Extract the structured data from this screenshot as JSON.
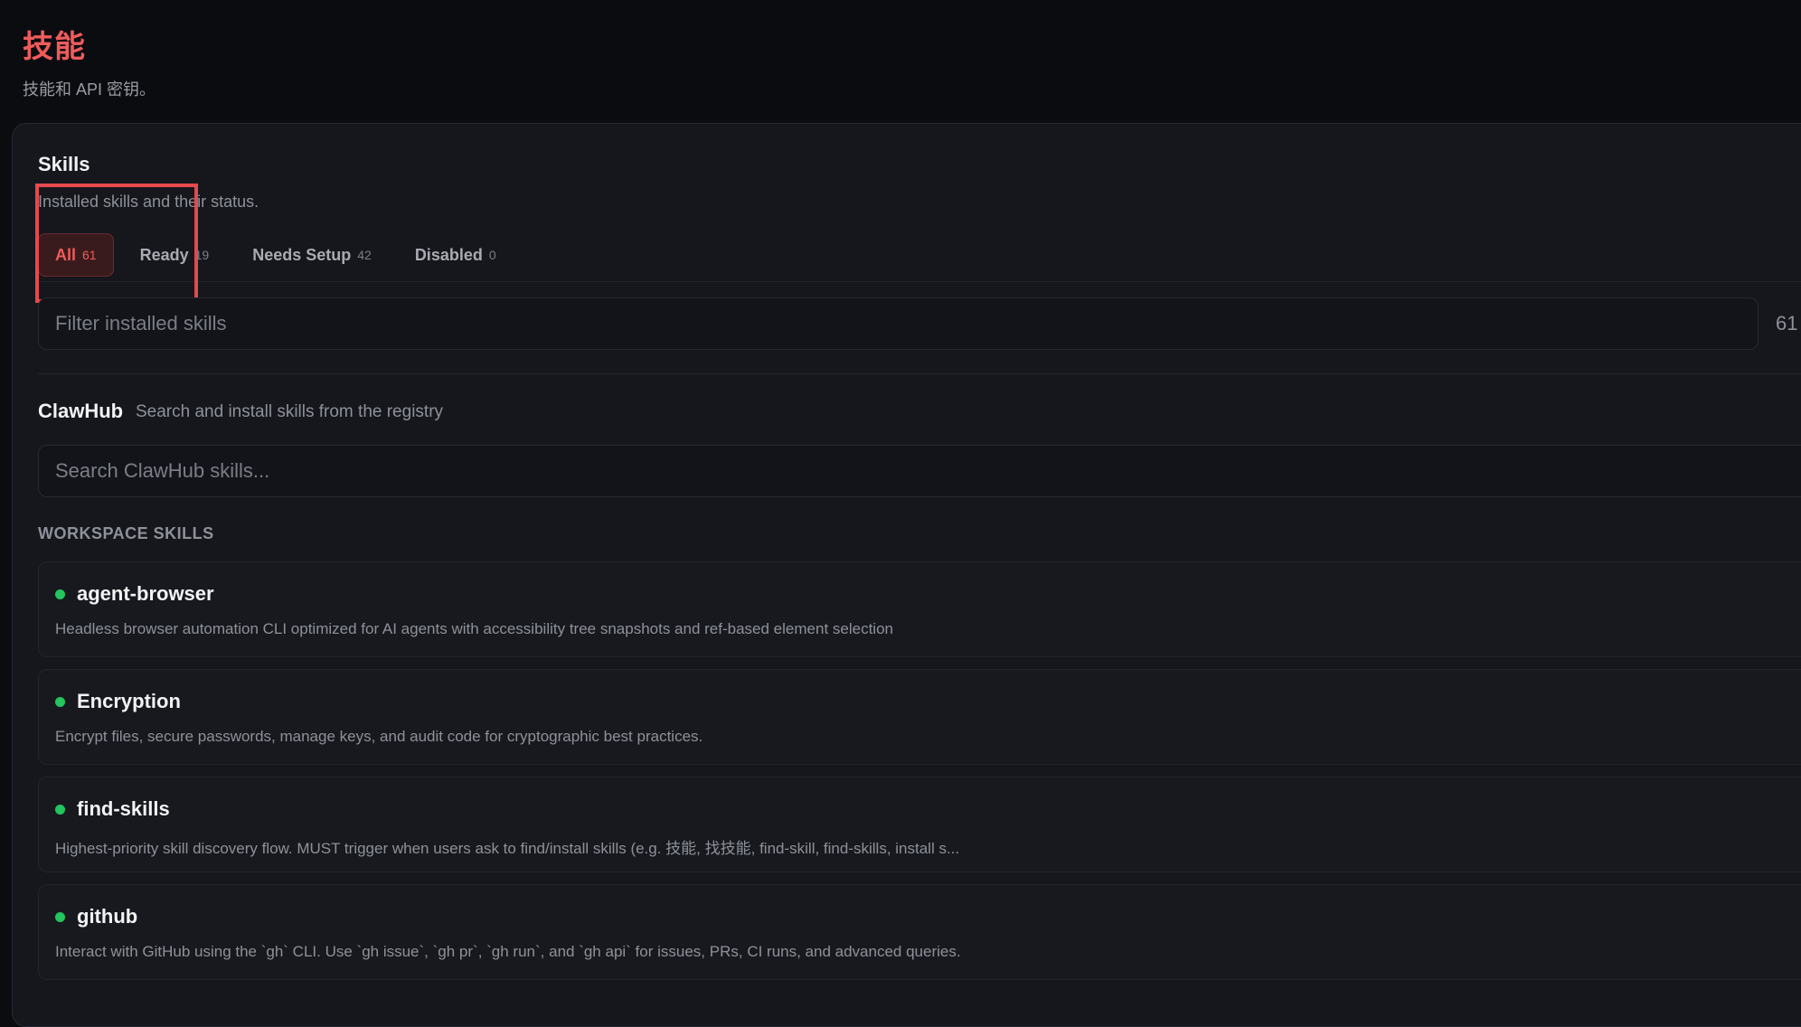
{
  "header": {
    "title": "技能",
    "subtitle": "技能和 API 密钥。"
  },
  "skills_section": {
    "title": "Skills",
    "description": "Installed skills and their status.",
    "tabs": [
      {
        "label": "All",
        "count": "61",
        "active": true
      },
      {
        "label": "Ready",
        "count": "19",
        "active": false
      },
      {
        "label": "Needs Setup",
        "count": "42",
        "active": false
      },
      {
        "label": "Disabled",
        "count": "0",
        "active": false
      }
    ],
    "filter": {
      "placeholder": "Filter installed skills",
      "count": "61"
    }
  },
  "clawhub": {
    "title": "ClawHub",
    "description": "Search and install skills from the registry",
    "search_placeholder": "Search ClawHub skills..."
  },
  "workspace": {
    "label": "WORKSPACE SKILLS",
    "items": [
      {
        "name": "agent-browser",
        "description": "Headless browser automation CLI optimized for AI agents with accessibility tree snapshots and ref-based element selection",
        "status_color": "#22c55e"
      },
      {
        "name": "Encryption",
        "description": "Encrypt files, secure passwords, manage keys, and audit code for cryptographic best practices.",
        "status_color": "#22c55e"
      },
      {
        "name": "find-skills",
        "description": "Highest-priority skill discovery flow. MUST trigger when users ask to find/install skills (e.g. 技能, 找技能, find-skill, find-skills, install s...",
        "status_color": "#22c55e"
      },
      {
        "name": "github",
        "description": "Interact with GitHub using the `gh` CLI. Use `gh issue`, `gh pr`, `gh run`, and `gh api` for issues, PRs, CI runs, and advanced queries.",
        "status_color": "#22c55e"
      }
    ]
  },
  "colors": {
    "accent": "#ef5b5b",
    "ready": "#22c55e",
    "highlight": "#e5484d"
  }
}
